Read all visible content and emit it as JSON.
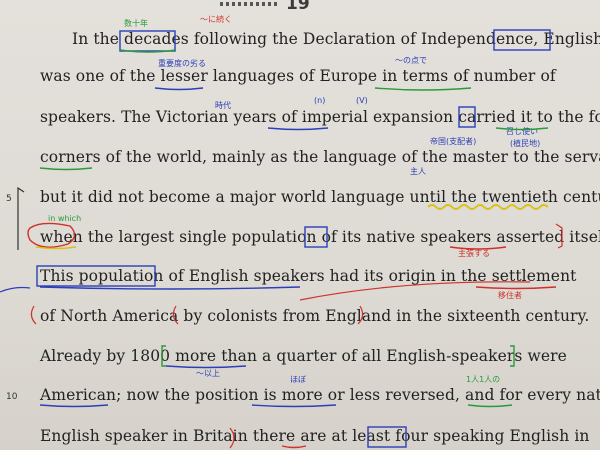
{
  "page_number": "19",
  "lines": [
    "In the decades following the Declaration of Independence, English",
    "was one of the lesser languages of Europe in terms of number of",
    "speakers. The Victorian years of imperial expansion carried it to the four",
    "corners of the world, mainly as the language of the master to the servant,",
    "but it did not become a major world language until the twentieth century,",
    "when the largest single population of its native speakers asserted itself.",
    "This population of English speakers had its origin in the settlement",
    "of North America by colonists from England in the sixteenth century.",
    "Already by 1800 more than a quarter of all English-speakers were",
    "American; now the position is more or less reversed, and for every native",
    "English speaker in Britain there are at least four speaking English in"
  ],
  "line_numbers": {
    "line5": "5",
    "line10": "10"
  },
  "annotations": {
    "green_decades": "数十年",
    "red_decades": "〜に続く",
    "blue_lesser": "重要度の劣る",
    "blue_terms": "〜の点で",
    "blue_years": "時代",
    "blue_n": "(n)",
    "blue_v": "(V)",
    "blue_master": "主人",
    "blue_empire": "帝国(支配者)",
    "blue_servant": "召し使い",
    "blue_servant2": "(植民地)",
    "green_when": "in which",
    "red_asserted": "主張する",
    "red_settlement": "移住者",
    "blue_more": "〜以上",
    "blue_more_less": "ほぼ",
    "green_every": "1人1人の"
  },
  "colors": {
    "ink_blue": "#2b3fb8",
    "ink_red": "#d0302a",
    "ink_green": "#2a9a3a",
    "ink_yellow": "#d8c21a"
  }
}
